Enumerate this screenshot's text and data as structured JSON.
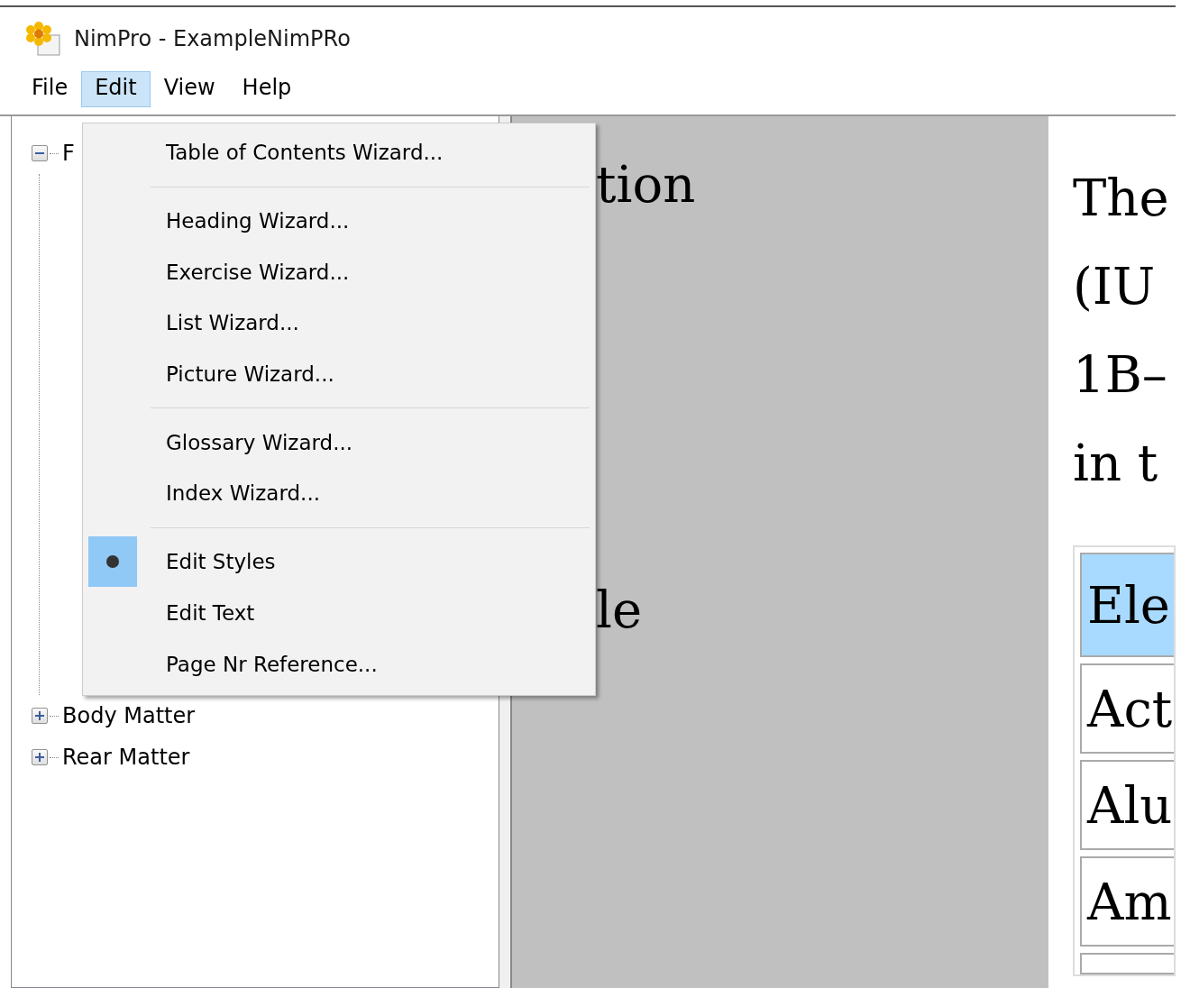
{
  "window": {
    "title": "NimPro - ExampleNimPRo"
  },
  "menu_bar": [
    {
      "label": "File",
      "selected": false
    },
    {
      "label": "Edit",
      "selected": true
    },
    {
      "label": "View",
      "selected": false
    },
    {
      "label": "Help",
      "selected": false
    }
  ],
  "edit_menu": [
    {
      "kind": "item",
      "label": "Table of Contents Wizard...",
      "checked": false
    },
    {
      "kind": "separator"
    },
    {
      "kind": "item",
      "label": "Heading Wizard...",
      "checked": false
    },
    {
      "kind": "item",
      "label": "Exercise Wizard...",
      "checked": false
    },
    {
      "kind": "item",
      "label": "List Wizard...",
      "checked": false
    },
    {
      "kind": "item",
      "label": "Picture Wizard...",
      "checked": false
    },
    {
      "kind": "separator"
    },
    {
      "kind": "item",
      "label": "Glossary Wizard...",
      "checked": false
    },
    {
      "kind": "item",
      "label": "Index Wizard...",
      "checked": false
    },
    {
      "kind": "separator"
    },
    {
      "kind": "item",
      "label": "Edit Styles",
      "checked": true
    },
    {
      "kind": "item",
      "label": "Edit Text",
      "checked": false
    },
    {
      "kind": "item",
      "label": "Page Nr Reference...",
      "checked": false
    }
  ],
  "tree": [
    {
      "label": "F",
      "expanded": true
    },
    {
      "label": "Body Matter",
      "expanded": false
    },
    {
      "label": "Rear Matter",
      "expanded": false
    }
  ],
  "document": {
    "headings": [
      "tion",
      "le"
    ],
    "lines": [
      "The",
      "(IU",
      "1B–",
      "in t"
    ],
    "table_rows": [
      {
        "kind": "header",
        "cell": "Ele"
      },
      {
        "kind": "body",
        "cell": "Act"
      },
      {
        "kind": "body",
        "cell": "Alu"
      },
      {
        "kind": "body",
        "cell": "Am"
      }
    ]
  }
}
